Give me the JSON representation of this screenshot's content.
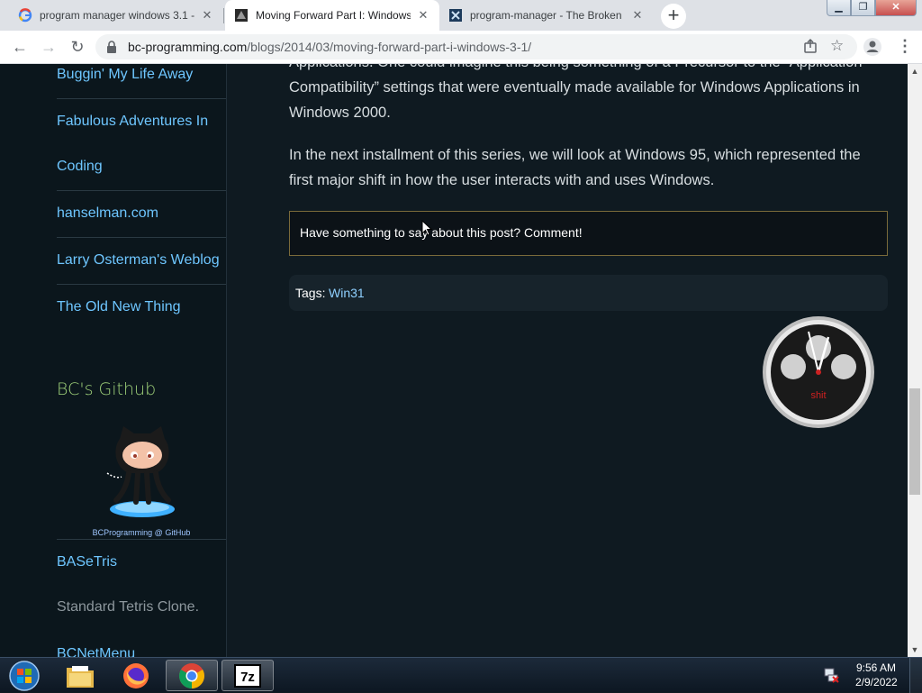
{
  "browser": {
    "tabs": [
      {
        "title": "program manager windows 3.1 -",
        "favicon": "google-icon",
        "active": false
      },
      {
        "title": "Moving Forward Part I: Windows",
        "favicon": "bc-site-icon",
        "active": true
      },
      {
        "title": "program-manager - The Broken",
        "favicon": "broken-site-icon",
        "active": false
      }
    ],
    "new_tab_label": "+",
    "url_host": "bc-programming.com",
    "url_path": "/blogs/2014/03/moving-forward-part-i-windows-3-1/"
  },
  "sidebar": {
    "links": [
      "Buggin' My Life Away",
      "Fabulous Adventures In",
      "Coding",
      "hanselman.com",
      "Larry Osterman's Weblog",
      "The Old New Thing"
    ],
    "github_heading": "BC's Github",
    "github_caption": "BCProgramming @ GitHub",
    "project_title": "BASeTris",
    "project_desc": "Standard Tetris Clone.",
    "next_project": "BCNetMenu"
  },
  "article": {
    "para1_partial": "Applications. One could imagine this being something of a Precursor to the “Application",
    "para1_line2": "Compatibility” settings that were eventually made available for Windows Applications in",
    "para1_line3": "Windows 2000.",
    "para2_line1": "In the next installment of this series, we will look at Windows 95, which represented the",
    "para2_line2": "first major shift in how the user interacts with and uses Windows.",
    "comment_prompt": "Have something to say about this post? Comment!",
    "tags_label": "Tags:",
    "tag": "Win31"
  },
  "clock_widget": {
    "label": "shit"
  },
  "taskbar": {
    "apps": [
      "start-orb-icon",
      "file-explorer-icon",
      "firefox-icon",
      "chrome-icon",
      "7zip-icon"
    ],
    "active_app": "chrome-icon",
    "time": "9:56 AM",
    "date": "2/9/2022"
  },
  "colors": {
    "link": "#6ec6ff",
    "heading_green": "#9fd17a",
    "page_bg": "#0f1a21"
  }
}
